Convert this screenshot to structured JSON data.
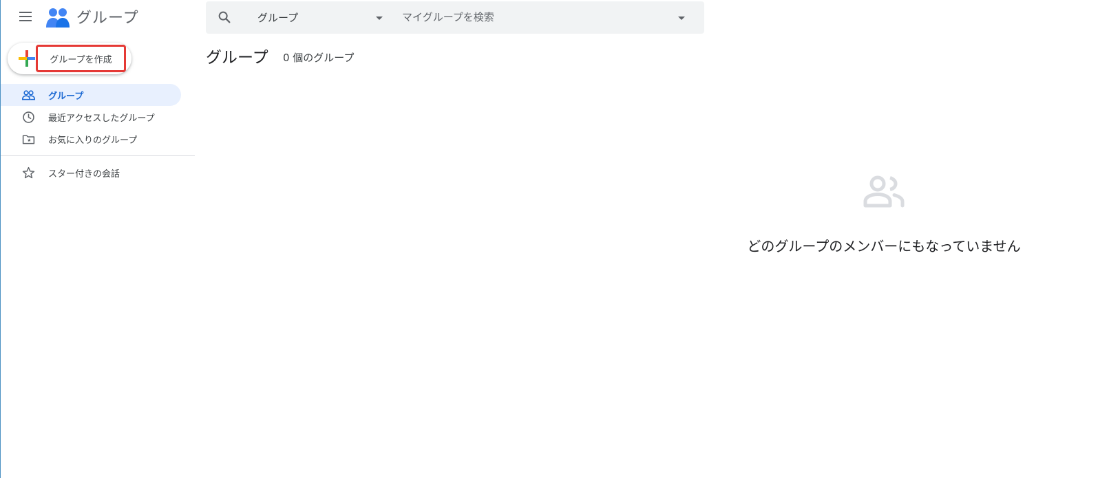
{
  "header": {
    "title": "グループ"
  },
  "search": {
    "scope_label": "グループ",
    "placeholder": "マイグループを検索"
  },
  "create_button": {
    "label": "グループを作成"
  },
  "sidebar": {
    "items": [
      {
        "label": "グループ",
        "icon": "people-icon",
        "active": true
      },
      {
        "label": "最近アクセスしたグループ",
        "icon": "clock-icon",
        "active": false
      },
      {
        "label": "お気に入りのグループ",
        "icon": "folder-star-icon",
        "active": false
      }
    ],
    "secondary_items": [
      {
        "label": "スター付きの会話",
        "icon": "star-icon",
        "active": false
      }
    ]
  },
  "main": {
    "title": "グループ",
    "count_text": "0 個のグループ",
    "empty_message": "どのグループのメンバーにもなっていません"
  },
  "colors": {
    "accent": "#1967d2",
    "active_bg": "#e8f0fe",
    "highlight_border": "#e53935"
  }
}
